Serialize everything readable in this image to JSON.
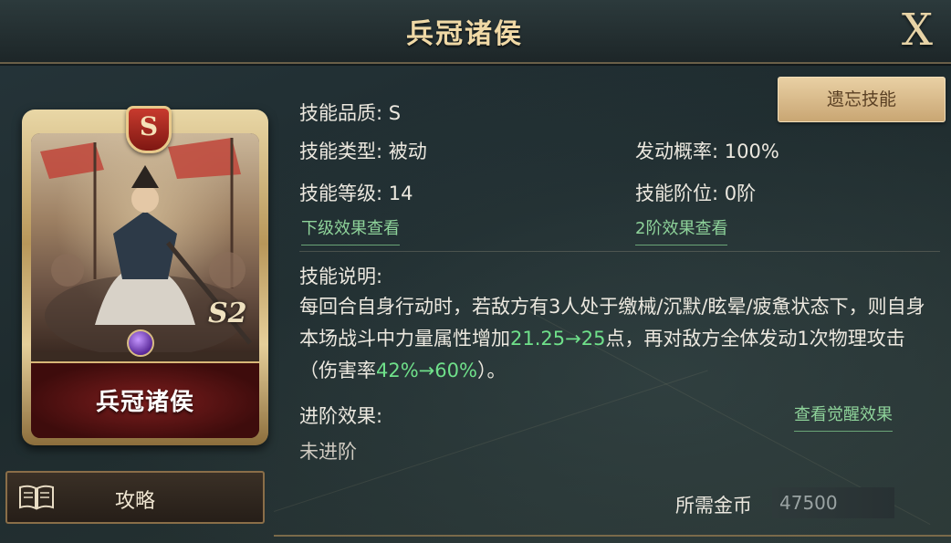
{
  "window": {
    "title": "兵冠诸侯",
    "close_label": "X"
  },
  "card": {
    "grade": "S",
    "name": "兵冠诸侯",
    "season": "S2"
  },
  "guide_button": {
    "label": "攻略",
    "icon": "book-icon"
  },
  "forget_button": {
    "label": "遗忘技能"
  },
  "skill": {
    "quality": "技能品质: S",
    "type": "技能类型: 被动",
    "level": "技能等级: 14",
    "trigger_rate": "发动概率: 100%",
    "tier": "技能阶位: 0阶",
    "next_level_link": "下级效果查看",
    "tier2_link": "2阶效果查看",
    "desc_label": "技能说明:",
    "desc_part1": "每回合自身行动时，若敌方有3人处于缴械/沉默/眩晕/疲惫状态下，则自身本场战斗中力量属性增加",
    "desc_hl1": "21.25→25",
    "desc_part2": "点，再对敌方全体发动1次物理攻击（伤害率",
    "desc_hl2": "42%→60%",
    "desc_part3": "）。",
    "advance_label": "进阶效果:",
    "advance_value": "未进阶",
    "awaken_link": "查看觉醒效果"
  },
  "cost": {
    "label": "所需金币",
    "value": "47500"
  },
  "colors": {
    "highlight_green": "#6fe08a",
    "link_green": "#8ed39a",
    "title_gold": "#f0d9a6"
  }
}
